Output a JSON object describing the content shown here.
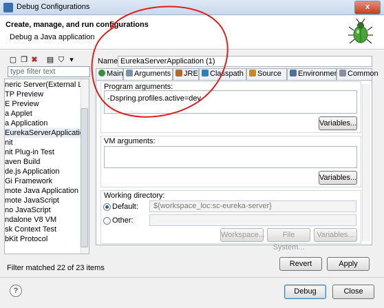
{
  "window": {
    "title": "Debug Configurations",
    "close_label": "x"
  },
  "header": {
    "title": "Create, manage, and run configurations",
    "subtitle": "Debug a Java application"
  },
  "sidebar": {
    "filter_placeholder": "type filter text",
    "items": [
      "neric Server(External Launc",
      "TP Preview",
      "E Preview",
      "a Applet",
      "a Application",
      "EurekaServerApplication (",
      "nit",
      "nit Plug-in Test",
      "aven Build",
      "de.js Application",
      "Gi Framework",
      "mote Java Application",
      "mote JavaScript",
      "no JavaScript",
      "ndalone V8 VM",
      "sk Context Test",
      "bKit Protocol"
    ],
    "filter_status": "Filter matched 22 of 23 items"
  },
  "config": {
    "name_label": "Name:",
    "name_value": "EurekaServerApplication (1)",
    "tabs": [
      {
        "label": "Main",
        "icon": "main-tab-icon"
      },
      {
        "label": "Arguments",
        "icon": "arguments-tab-icon"
      },
      {
        "label": "JRE",
        "icon": "jre-tab-icon"
      },
      {
        "label": "Classpath",
        "icon": "classpath-tab-icon"
      },
      {
        "label": "Source",
        "icon": "source-tab-icon"
      },
      {
        "label": "Environment",
        "icon": "environment-tab-icon"
      },
      {
        "label": "Common",
        "icon": "common-tab-icon"
      }
    ],
    "program_args_label": "Program arguments:",
    "program_args_value": "-Dspring.profiles.active=dev",
    "vm_args_label": "VM arguments:",
    "vm_args_value": "",
    "variables_label": "Variables...",
    "workdir_label": "Working directory:",
    "default_label": "Default:",
    "default_value": "${workspace_loc:sc-eureka-server}",
    "other_label": "Other:",
    "other_value": "",
    "workspace_btn": "Workspace...",
    "filesystem_btn": "File System...",
    "variables_btn": "Variables...",
    "revert_label": "Revert",
    "apply_label": "Apply"
  },
  "footer": {
    "help_label": "?",
    "debug_label": "Debug",
    "close_label": "Close"
  },
  "colors": {
    "annotation": "#e01e1e",
    "accent": "#3c7fb1"
  }
}
